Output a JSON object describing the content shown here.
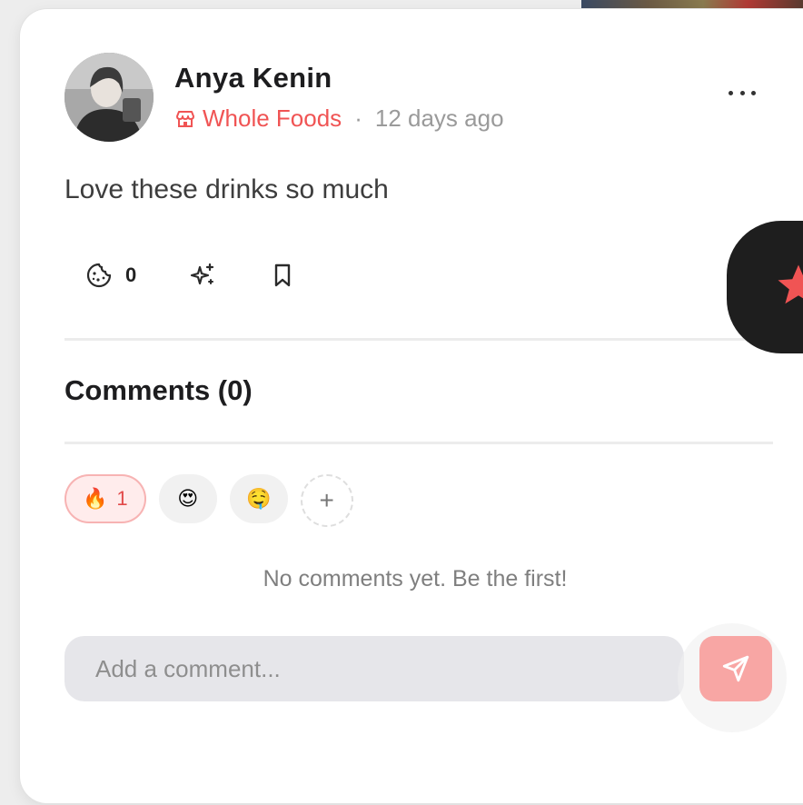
{
  "post": {
    "author": "Anya Kenin",
    "store": "Whole Foods",
    "separator": "·",
    "time_ago": "12 days ago",
    "text": "Love these drinks so much"
  },
  "actions": {
    "cookie_count": "0"
  },
  "comments": {
    "title": "Comments (0)",
    "empty_message": "No comments yet. Be the first!",
    "input_placeholder": "Add a comment..."
  },
  "reactions": [
    {
      "emoji": "🔥",
      "count": "1",
      "active": true
    },
    {
      "emoji": "😍",
      "active": false
    },
    {
      "emoji": "🤤",
      "active": false
    }
  ],
  "add_reaction_label": "+",
  "icons": {
    "more": "more-horizontal-icon",
    "store": "store-icon",
    "cookie": "cookie-icon",
    "sparkle": "sparkles-icon",
    "bookmark": "bookmark-icon",
    "send": "send-icon",
    "fab": "star-icon"
  },
  "colors": {
    "accent": "#f05454",
    "send_button": "#f8a6a4",
    "active_reaction_bg": "#ffecec",
    "fab_bg": "#1e1e1e"
  }
}
